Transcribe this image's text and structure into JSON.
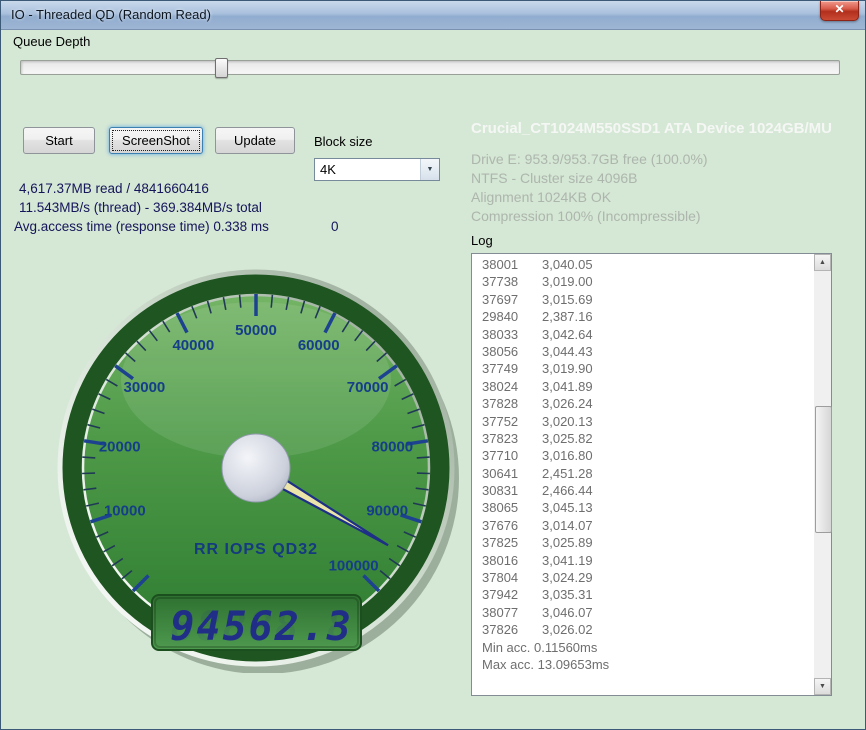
{
  "window": {
    "title": "IO - Threaded QD (Random Read)"
  },
  "icons": {
    "close": "✕",
    "dropdown": "▼",
    "scroll_up": "▲",
    "scroll_down": "▼"
  },
  "queue_depth": {
    "label": "Queue Depth"
  },
  "toolbar": {
    "start": "Start",
    "screenshot": "ScreenShot",
    "update": "Update",
    "block_size_label": "Block size",
    "block_size_value": "4K"
  },
  "stats": {
    "read_total": "4,617.37MB read / 4841660416",
    "throughput": "11.543MB/s (thread) - 369.384MB/s total",
    "access_time": "Avg.access time (response time) 0.338 ms",
    "counter": "0"
  },
  "device": {
    "title": "Crucial_CT1024M550SSD1 ATA Device 1024GB/MU",
    "lines": [
      "Drive E: 953.9/953.7GB free (100.0%)",
      "NTFS - Cluster size 4096B",
      "Alignment 1024KB OK",
      "Compression 100% (Incompressible)"
    ]
  },
  "log": {
    "label": "Log",
    "entries": [
      [
        "38001",
        "3,040.05"
      ],
      [
        "37738",
        "3,019.00"
      ],
      [
        "37697",
        "3,015.69"
      ],
      [
        "29840",
        "2,387.16"
      ],
      [
        "38033",
        "3,042.64"
      ],
      [
        "38056",
        "3,044.43"
      ],
      [
        "37749",
        "3,019.90"
      ],
      [
        "38024",
        "3,041.89"
      ],
      [
        "37828",
        "3,026.24"
      ],
      [
        "37752",
        "3,020.13"
      ],
      [
        "37823",
        "3,025.82"
      ],
      [
        "37710",
        "3,016.80"
      ],
      [
        "30641",
        "2,451.28"
      ],
      [
        "30831",
        "2,466.44"
      ],
      [
        "38065",
        "3,045.13"
      ],
      [
        "37676",
        "3,014.07"
      ],
      [
        "37825",
        "3,025.89"
      ],
      [
        "38016",
        "3,041.19"
      ],
      [
        "37804",
        "3,024.29"
      ],
      [
        "37942",
        "3,035.31"
      ],
      [
        "38077",
        "3,046.07"
      ],
      [
        "37826",
        "3,026.02"
      ]
    ],
    "footer": [
      "Min acc. 0.11560ms",
      "Max acc. 13.09653ms"
    ]
  },
  "gauge": {
    "label": "RR IOPS QD32",
    "display": "94562.3",
    "ghost": "88888.8",
    "value": 94562.3,
    "min": 0,
    "max": 100000,
    "major_step": 10000,
    "minor_step": 2000,
    "min_angle": -135,
    "max_angle": 135,
    "tick_labels": [
      "10000",
      "20000",
      "30000",
      "40000",
      "50000",
      "60000",
      "70000",
      "80000",
      "90000",
      "100000"
    ]
  },
  "colors": {
    "window_bg": "#d5e7d5",
    "gauge_rim": "#1e5520",
    "gauge_face_top": "#73b364",
    "gauge_face_bottom": "#2e7c31",
    "tick_navy": "#1d4390",
    "lcd_digit_navy": "#202e88",
    "needle_yellow": "#ebe5a9",
    "device_title_white": "#f5f7f5",
    "device_text_gray": "#adb6ad",
    "stats_navy": "#15155a"
  }
}
